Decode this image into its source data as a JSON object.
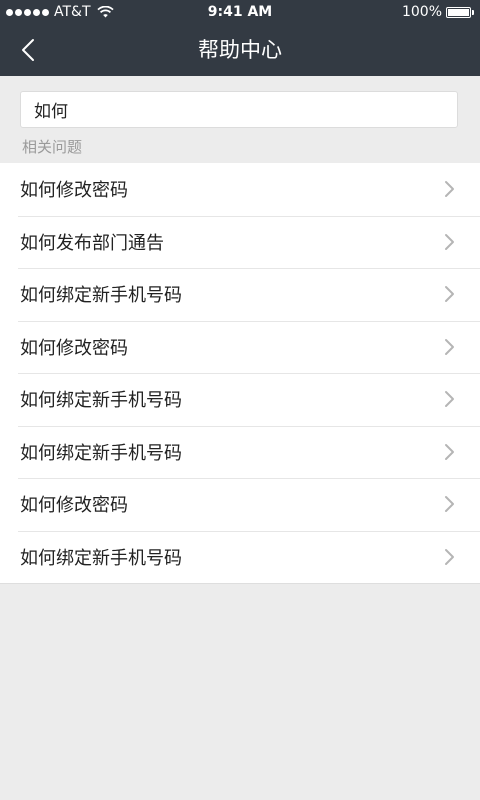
{
  "status_bar": {
    "carrier": "AT&T",
    "time": "9:41 AM",
    "battery": "100%",
    "battery_level": 1.0
  },
  "nav": {
    "title": "帮助中心",
    "back_icon": "back-chevron-icon"
  },
  "search": {
    "value": "如何",
    "placeholder": ""
  },
  "section_label": "相关问题",
  "items": [
    {
      "label": "如何修改密码"
    },
    {
      "label": "如何发布部门通告"
    },
    {
      "label": "如何绑定新手机号码"
    },
    {
      "label": "如何修改密码"
    },
    {
      "label": "如何绑定新手机号码"
    },
    {
      "label": "如何绑定新手机号码"
    },
    {
      "label": "如何修改密码"
    },
    {
      "label": "如何绑定新手机号码"
    }
  ],
  "colors": {
    "header_bg": "#333a43",
    "page_bg": "#ececec",
    "caret": "#2c7be5"
  }
}
